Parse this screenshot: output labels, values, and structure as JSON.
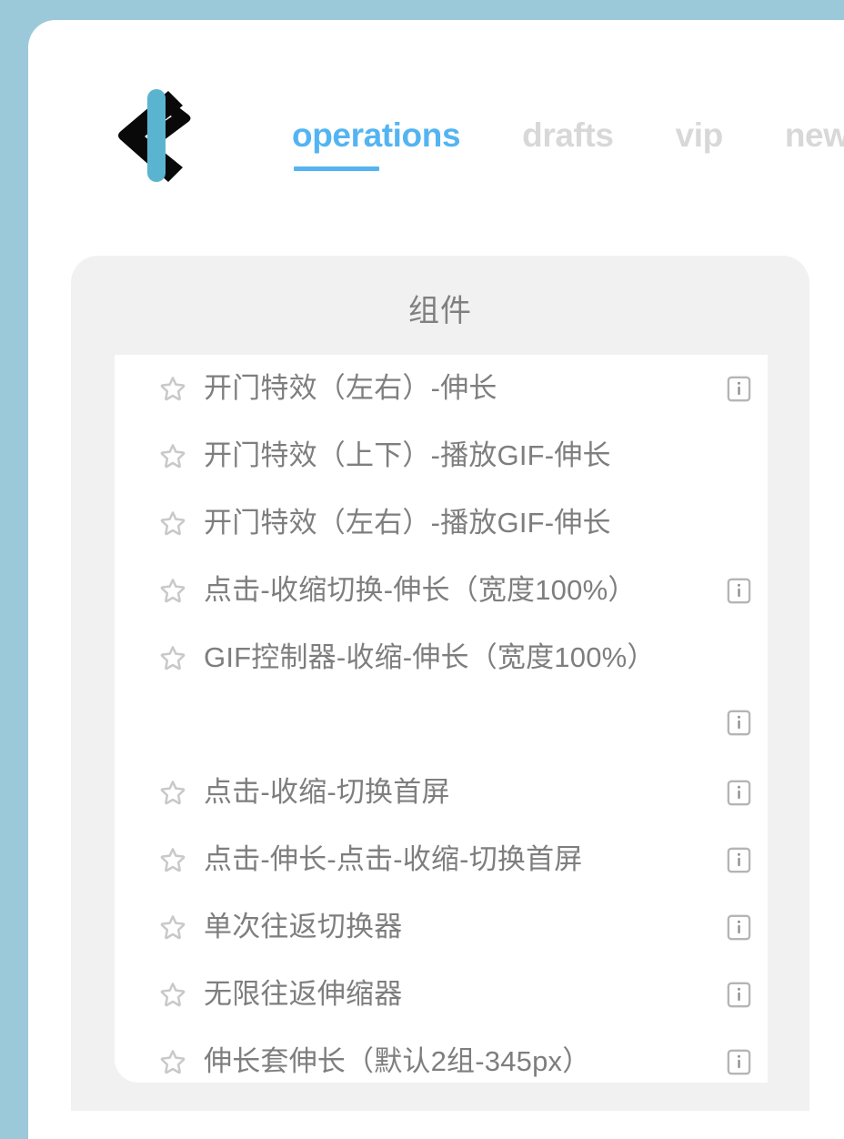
{
  "theme": {
    "page_background": "#9bc9da",
    "card_background": "#ffffff",
    "panel_background": "#f1f1f1",
    "list_background": "#ffffff",
    "accent": "#54b4f2",
    "tab_inactive": "#d8d8d8",
    "text_muted": "#7e7e7e",
    "title_color": "#808080",
    "logo_dark": "#090909",
    "logo_blue": "#5bb4cf"
  },
  "header": {
    "logo_name": "code-bracket-logo",
    "tabs": [
      {
        "label": "operations",
        "active": true
      },
      {
        "label": "drafts",
        "active": false
      },
      {
        "label": "vip",
        "active": false
      },
      {
        "label": "new",
        "active": false
      }
    ]
  },
  "panel": {
    "title": "组件",
    "items": [
      {
        "label": "开门特效（左右）-伸长",
        "starred": false,
        "has_info": true,
        "wraps": false
      },
      {
        "label": "开门特效（上下）-播放GIF-伸长",
        "starred": false,
        "has_info": false,
        "wraps": false
      },
      {
        "label": "开门特效（左右）-播放GIF-伸长",
        "starred": false,
        "has_info": false,
        "wraps": false
      },
      {
        "label": "点击-收缩切换-伸长（宽度100%）",
        "starred": false,
        "has_info": true,
        "wraps": false
      },
      {
        "label": "GIF控制器-收缩-伸长（宽度100%）",
        "starred": false,
        "has_info": true,
        "wraps": true
      },
      {
        "label": "点击-收缩-切换首屏",
        "starred": false,
        "has_info": true,
        "wraps": false
      },
      {
        "label": "点击-伸长-点击-收缩-切换首屏",
        "starred": false,
        "has_info": true,
        "wraps": false
      },
      {
        "label": "单次往返切换器",
        "starred": false,
        "has_info": true,
        "wraps": false
      },
      {
        "label": "无限往返伸缩器",
        "starred": false,
        "has_info": true,
        "wraps": false
      },
      {
        "label": "伸长套伸长（默认2组-345px）",
        "starred": false,
        "has_info": true,
        "wraps": false
      }
    ]
  },
  "icons": {
    "star": "star-outline-icon",
    "info": "info-square-icon"
  }
}
